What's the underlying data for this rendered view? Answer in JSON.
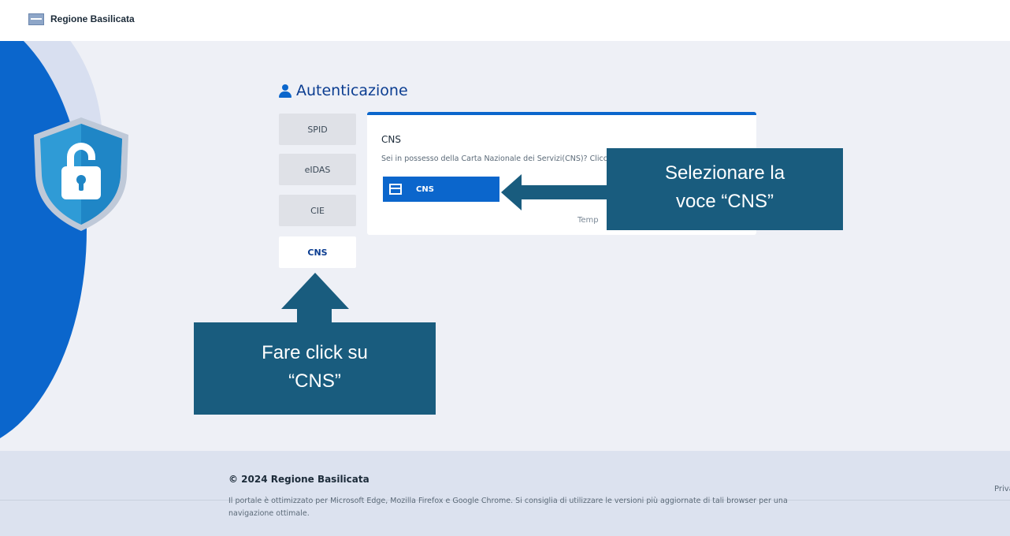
{
  "header": {
    "brand": "Regione Basilicata",
    "logo_icon": "region-crest-icon"
  },
  "auth": {
    "title": "Autenticazione",
    "title_icon": "user-icon",
    "tabs": [
      {
        "label": "SPID",
        "active": false
      },
      {
        "label": "eIDAS",
        "active": false
      },
      {
        "label": "CIE",
        "active": false
      },
      {
        "label": "CNS",
        "active": true
      }
    ]
  },
  "card": {
    "title": "CNS",
    "description": "Sei in possesso della Carta Nazionale dei Servizi(CNS)? Clicc",
    "button_label": "CNS",
    "button_icon": "card-icon",
    "footer_text": "Temp"
  },
  "callouts": {
    "right": {
      "line1": "Selezionare la",
      "line2": "voce “CNS”"
    },
    "bottom": {
      "line1": "Fare click su",
      "line2": "“CNS”"
    }
  },
  "illustration": {
    "icon": "shield-lock-icon"
  },
  "footer": {
    "copyright": "© 2024 Regione Basilicata",
    "note": "Il portale è ottimizzato per Microsoft Edge, Mozilla Firefox e Google Chrome. Si consiglia di utilizzare le versioni più aggiornate di tali browser per una navigazione ottimale.",
    "privacy_link": "Priva"
  },
  "colors": {
    "primary": "#0b66cc",
    "callout": "#195c7e",
    "background": "#eef0f6",
    "footer": "#dce2ef"
  }
}
